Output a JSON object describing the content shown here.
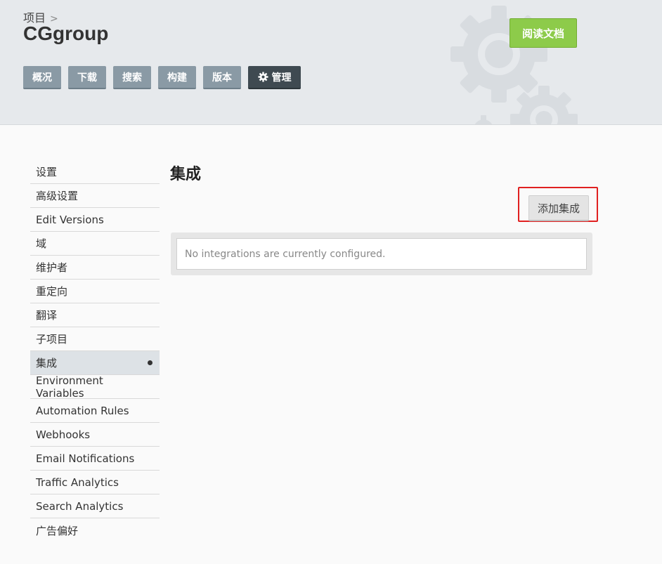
{
  "header": {
    "breadcrumb": "项目",
    "breadcrumb_sep": ">",
    "project_name": "CGgroup",
    "docs_button": "阅读文档",
    "nav": [
      {
        "label": "概况"
      },
      {
        "label": "下载"
      },
      {
        "label": "搜索"
      },
      {
        "label": "构建"
      },
      {
        "label": "版本"
      },
      {
        "label": "管理",
        "icon": "gear-icon",
        "active": true
      }
    ]
  },
  "sidebar": {
    "items": [
      {
        "label": "设置"
      },
      {
        "label": "高级设置"
      },
      {
        "label": "Edit Versions"
      },
      {
        "label": "域"
      },
      {
        "label": "维护者"
      },
      {
        "label": "重定向"
      },
      {
        "label": "翻译"
      },
      {
        "label": "子项目"
      },
      {
        "label": "集成",
        "active": true
      },
      {
        "label": "Environment Variables"
      },
      {
        "label": "Automation Rules"
      },
      {
        "label": "Webhooks"
      },
      {
        "label": "Email Notifications"
      },
      {
        "label": "Traffic Analytics"
      },
      {
        "label": "Search Analytics"
      },
      {
        "label": "广告偏好"
      }
    ]
  },
  "main": {
    "title": "集成",
    "add_button": "添加集成",
    "empty_message": "No integrations are currently configured."
  },
  "colors": {
    "header_bg": "#e6e9ec",
    "nav_button": "#8a9aa5",
    "nav_active": "#3f4a51",
    "docs_button": "#8dcb4a",
    "highlight": "#e02020"
  }
}
